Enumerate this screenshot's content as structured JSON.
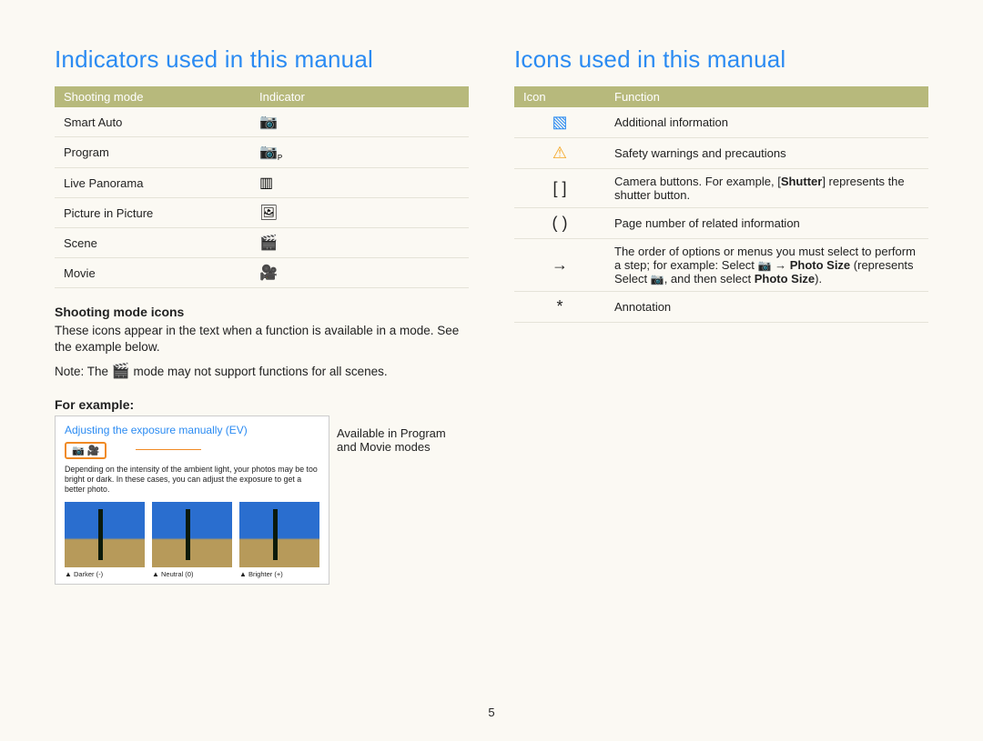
{
  "left": {
    "title": "Indicators used in this manual",
    "table": {
      "head_mode": "Shooting mode",
      "head_ind": "Indicator",
      "rows": [
        {
          "mode": "Smart Auto",
          "indicator": "smart-auto"
        },
        {
          "mode": "Program",
          "indicator": "program"
        },
        {
          "mode": "Live Panorama",
          "indicator": "panorama"
        },
        {
          "mode": "Picture in Picture",
          "indicator": "pip"
        },
        {
          "mode": "Scene",
          "indicator": "scene"
        },
        {
          "mode": "Movie",
          "indicator": "movie"
        }
      ]
    },
    "sub1": "Shooting mode icons",
    "p1": "These icons appear in the text when a function is available in a mode. See the example below.",
    "note_prefix": "Note: The ",
    "note_suffix": " mode may not support functions for all scenes.",
    "sub2": "For example:",
    "example": {
      "title": "Adjusting the exposure manually (EV)",
      "hl_icons": "📷 🎥",
      "body": "Depending on the intensity of the ambient light, your photos may be too bright or dark. In these cases, you can adjust the exposure to get a better photo.",
      "caps": [
        "Darker (-)",
        "Neutral (0)",
        "Brighter (+)"
      ]
    },
    "annotation": "Available in Program and Movie modes"
  },
  "right": {
    "title": "Icons used in this manual",
    "table": {
      "head_icon": "Icon",
      "head_func": "Function",
      "rows": [
        {
          "icon": "note",
          "func_plain": "Additional information"
        },
        {
          "icon": "warn",
          "func_plain": "Safety warnings and precautions"
        },
        {
          "icon": "[ ]",
          "func_prefix": "Camera buttons. For example, [",
          "func_bold1": "Shutter",
          "func_suffix1": "] represents the shutter button."
        },
        {
          "icon": "( )",
          "func_plain": "Page number of related information"
        },
        {
          "icon": "→",
          "func_prefix": "The order of options or menus you must select to perform a step; for example: Select ",
          "func_cam": "📷",
          "func_arrow": " → ",
          "func_bold1": "Photo Size",
          "func_paren_open": " (represents Select ",
          "func_cam2": "📷",
          "func_paren_mid": ", and then select ",
          "func_bold2": "Photo Size",
          "func_paren_close": ")."
        },
        {
          "icon": "*",
          "func_plain": "Annotation"
        }
      ]
    }
  },
  "page_number": "5"
}
